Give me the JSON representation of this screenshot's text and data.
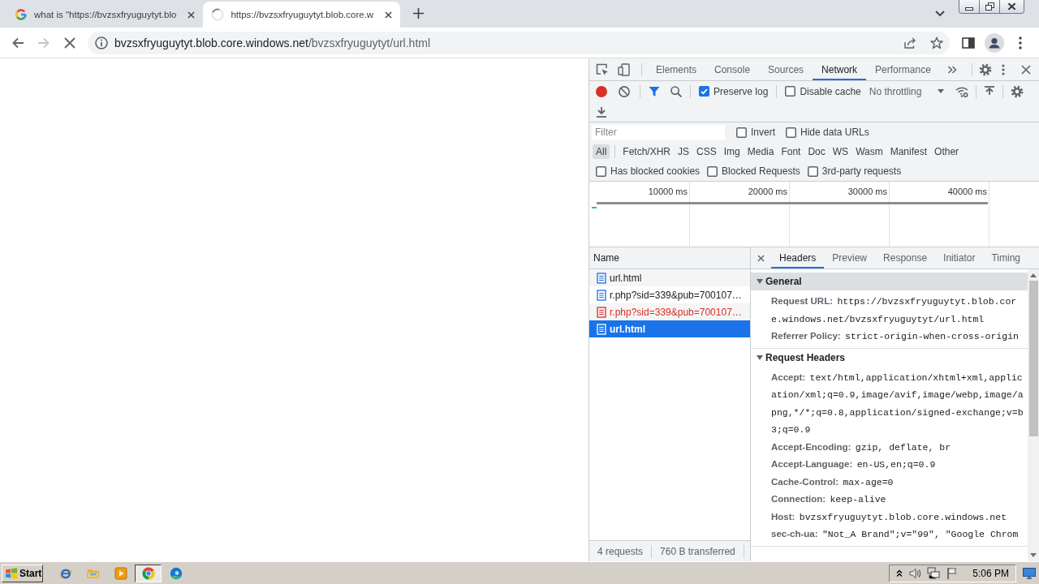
{
  "browser_tabs": [
    {
      "title": "what is \"https://bvzsxfryuguytyt.blo",
      "loading": false,
      "selected": false
    },
    {
      "title": "https://bvzsxfryuguytyt.blob.core.w",
      "loading": true,
      "selected": true
    }
  ],
  "navigation": {
    "forward_disabled": true,
    "loading": true
  },
  "address_bar": {
    "host": "bvzsxfryuguytyt.blob.core.windows.net",
    "path": "/bvzsxfryuguytyt/url.html"
  },
  "devtools": {
    "tabs": [
      {
        "label": "Elements",
        "selected": false
      },
      {
        "label": "Console",
        "selected": false
      },
      {
        "label": "Sources",
        "selected": false
      },
      {
        "label": "Network",
        "selected": true
      },
      {
        "label": "Performance",
        "selected": false
      }
    ],
    "network_toolbar": {
      "recording": true,
      "filter_shown": true,
      "options": [
        {
          "label": "Preserve log",
          "checked": true
        },
        {
          "label": "Disable cache",
          "checked": false
        }
      ],
      "throttling": "No throttling"
    },
    "filter_bar": {
      "placeholder": "Filter",
      "options": [
        {
          "label": "Invert",
          "checked": false
        },
        {
          "label": "Hide data URLs",
          "checked": false
        }
      ],
      "types": [
        {
          "label": "All",
          "selected": true
        },
        {
          "label": "Fetch/XHR",
          "selected": false
        },
        {
          "label": "JS",
          "selected": false
        },
        {
          "label": "CSS",
          "selected": false
        },
        {
          "label": "Img",
          "selected": false
        },
        {
          "label": "Media",
          "selected": false
        },
        {
          "label": "Font",
          "selected": false
        },
        {
          "label": "Doc",
          "selected": false
        },
        {
          "label": "WS",
          "selected": false
        },
        {
          "label": "Wasm",
          "selected": false
        },
        {
          "label": "Manifest",
          "selected": false
        },
        {
          "label": "Other",
          "selected": false
        }
      ],
      "blocked_options": [
        {
          "label": "Has blocked cookies",
          "checked": false
        },
        {
          "label": "Blocked Requests",
          "checked": false
        },
        {
          "label": "3rd-party requests",
          "checked": false
        }
      ]
    },
    "overview": {
      "ticks": [
        "10000 ms",
        "20000 ms",
        "30000 ms",
        "40000 ms"
      ]
    },
    "request_list": {
      "column": "Name",
      "rows": [
        {
          "name": "url.html",
          "failed": false,
          "selected": false
        },
        {
          "name": "r.php?sid=339&pub=700107…",
          "failed": false,
          "selected": false
        },
        {
          "name": "r.php?sid=339&pub=700107…",
          "failed": true,
          "selected": false
        },
        {
          "name": "url.html",
          "failed": false,
          "selected": true
        }
      ],
      "summary": [
        "4 requests",
        "760 B transferred"
      ]
    },
    "details": {
      "tabs": [
        {
          "label": "Headers",
          "selected": true
        },
        {
          "label": "Preview",
          "selected": false
        },
        {
          "label": "Response",
          "selected": false
        },
        {
          "label": "Initiator",
          "selected": false
        },
        {
          "label": "Timing",
          "selected": false
        }
      ],
      "sections": [
        {
          "title": "General",
          "expanded": true,
          "selected": true,
          "rows": [
            {
              "name": "Request URL:",
              "value": "https://bvzsxfryuguytyt.blob.core.windows.net/bvzsxfryuguytyt/url.html"
            },
            {
              "name": "Referrer Policy:",
              "value": "strict-origin-when-cross-origin"
            }
          ]
        },
        {
          "title": "Request Headers",
          "expanded": true,
          "selected": false,
          "rows": [
            {
              "name": "Accept:",
              "value": "text/html,application/xhtml+xml,application/xml;q=0.9,image/avif,image/webp,image/apng,*/*;q=0.8,application/signed-exchange;v=b3;q=0.9"
            },
            {
              "name": "Accept-Encoding:",
              "value": "gzip, deflate, br"
            },
            {
              "name": "Accept-Language:",
              "value": "en-US,en;q=0.9"
            },
            {
              "name": "Cache-Control:",
              "value": "max-age=0"
            },
            {
              "name": "Connection:",
              "value": "keep-alive"
            },
            {
              "name": "Host:",
              "value": "bvzsxfryuguytyt.blob.core.windows.net"
            },
            {
              "name": "sec-ch-ua:",
              "value": "\"Not_A Brand\";v=\"99\", \"Google Chrom"
            }
          ]
        }
      ]
    }
  },
  "taskbar": {
    "start": "Start",
    "apps": [
      {
        "selected": false
      },
      {
        "selected": false
      },
      {
        "selected": false
      },
      {
        "selected": true
      },
      {
        "selected": false
      }
    ],
    "clock": "5:06 PM"
  }
}
